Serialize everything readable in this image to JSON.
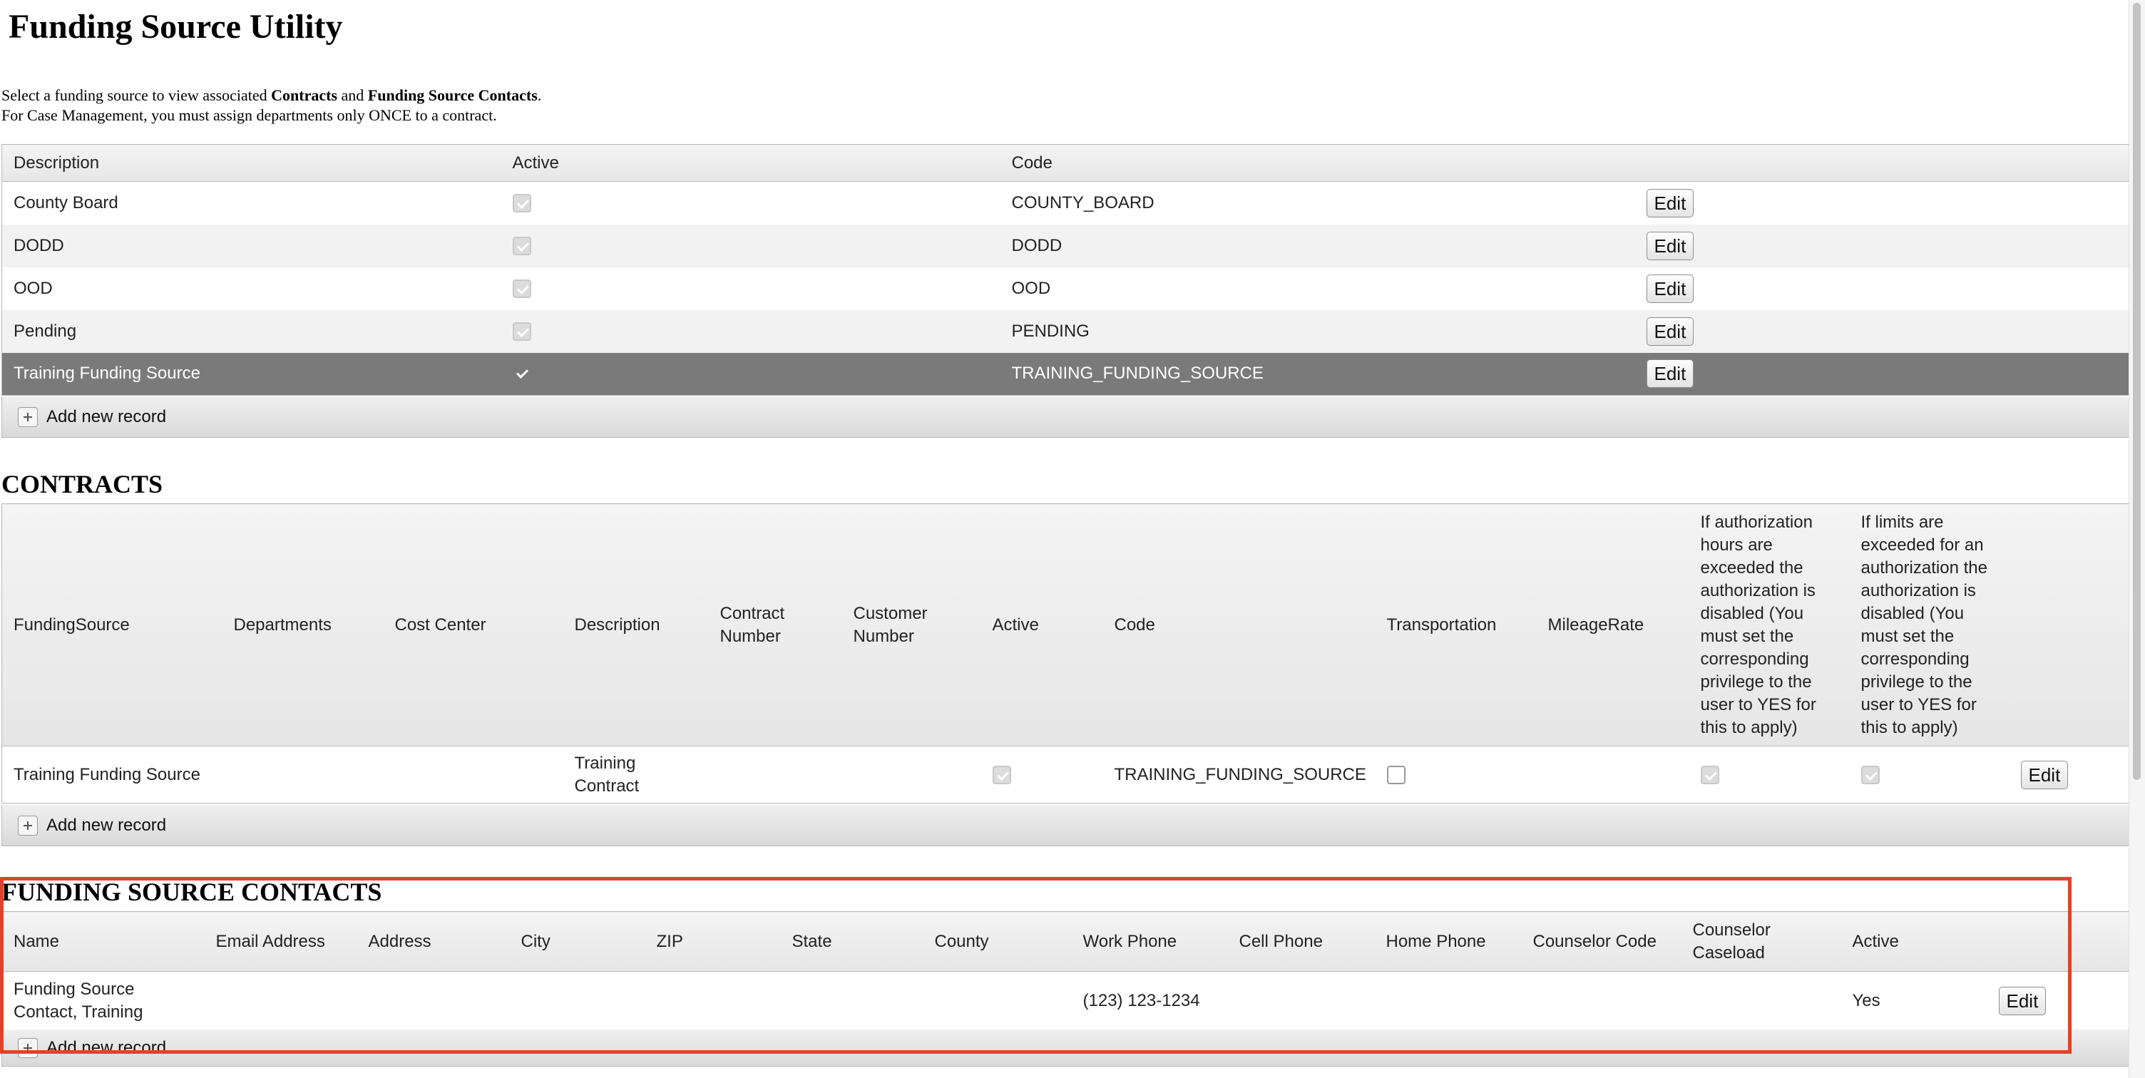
{
  "page": {
    "title": "Funding Source Utility",
    "intro_line1_pre": "Select a funding source to view associated ",
    "intro_contracts": "Contracts",
    "intro_and": " and ",
    "intro_contacts": "Funding Source Contacts",
    "intro_period": ".",
    "intro_line2": "For Case Management, you must assign departments only ONCE to a contract."
  },
  "funding_sources": {
    "headers": [
      "Description",
      "Active",
      "Code"
    ],
    "rows": [
      {
        "description": "County Board",
        "active": true,
        "code": "COUNTY_BOARD"
      },
      {
        "description": "DODD",
        "active": true,
        "code": "DODD"
      },
      {
        "description": "OOD",
        "active": true,
        "code": "OOD"
      },
      {
        "description": "Pending",
        "active": true,
        "code": "PENDING"
      },
      {
        "description": "Training Funding Source",
        "active": true,
        "code": "TRAINING_FUNDING_SOURCE",
        "selected": true
      }
    ],
    "edit_label": "Edit",
    "add_label": "Add new record"
  },
  "contracts": {
    "title": "CONTRACTS",
    "headers": [
      "FundingSource",
      "Departments",
      "Cost Center",
      "Description",
      "Contract Number",
      "Customer Number",
      "Active",
      "Code",
      "Transportation",
      "MileageRate",
      "If authorization hours are exceeded the authorization is disabled (You must set the corresponding privilege to the user to YES for this to apply)",
      "If limits are exceeded for an authorization the authorization is disabled (You must set the corresponding privilege to the user to YES for this to apply)"
    ],
    "rows": [
      {
        "funding_source": "Training Funding Source",
        "departments": "",
        "cost_center": "",
        "description": "Training Contract",
        "contract_number": "",
        "customer_number": "",
        "active": true,
        "code": "TRAINING_FUNDING_SOURCE",
        "transportation": false,
        "mileage_rate": "",
        "auth_hours_disable": true,
        "limits_disable": true
      }
    ],
    "edit_label": "Edit",
    "add_label": "Add new record"
  },
  "contacts": {
    "title": "FUNDING SOURCE CONTACTS",
    "headers": [
      "Name",
      "Email Address",
      "Address",
      "City",
      "ZIP",
      "State",
      "County",
      "Work Phone",
      "Cell Phone",
      "Home Phone",
      "Counselor Code",
      "Counselor Caseload",
      "Active"
    ],
    "rows": [
      {
        "name": "Funding Source Contact, Training",
        "email": "",
        "address": "",
        "city": "",
        "zip": "",
        "state": "",
        "county": "",
        "work_phone": "(123) 123-1234",
        "cell_phone": "",
        "home_phone": "",
        "counselor_code": "",
        "counselor_caseload": "",
        "active": "Yes"
      }
    ],
    "edit_label": "Edit",
    "add_label": "Add new record"
  },
  "colors": {
    "highlight": "#e0432d",
    "selected_row": "#7a7a7a"
  }
}
